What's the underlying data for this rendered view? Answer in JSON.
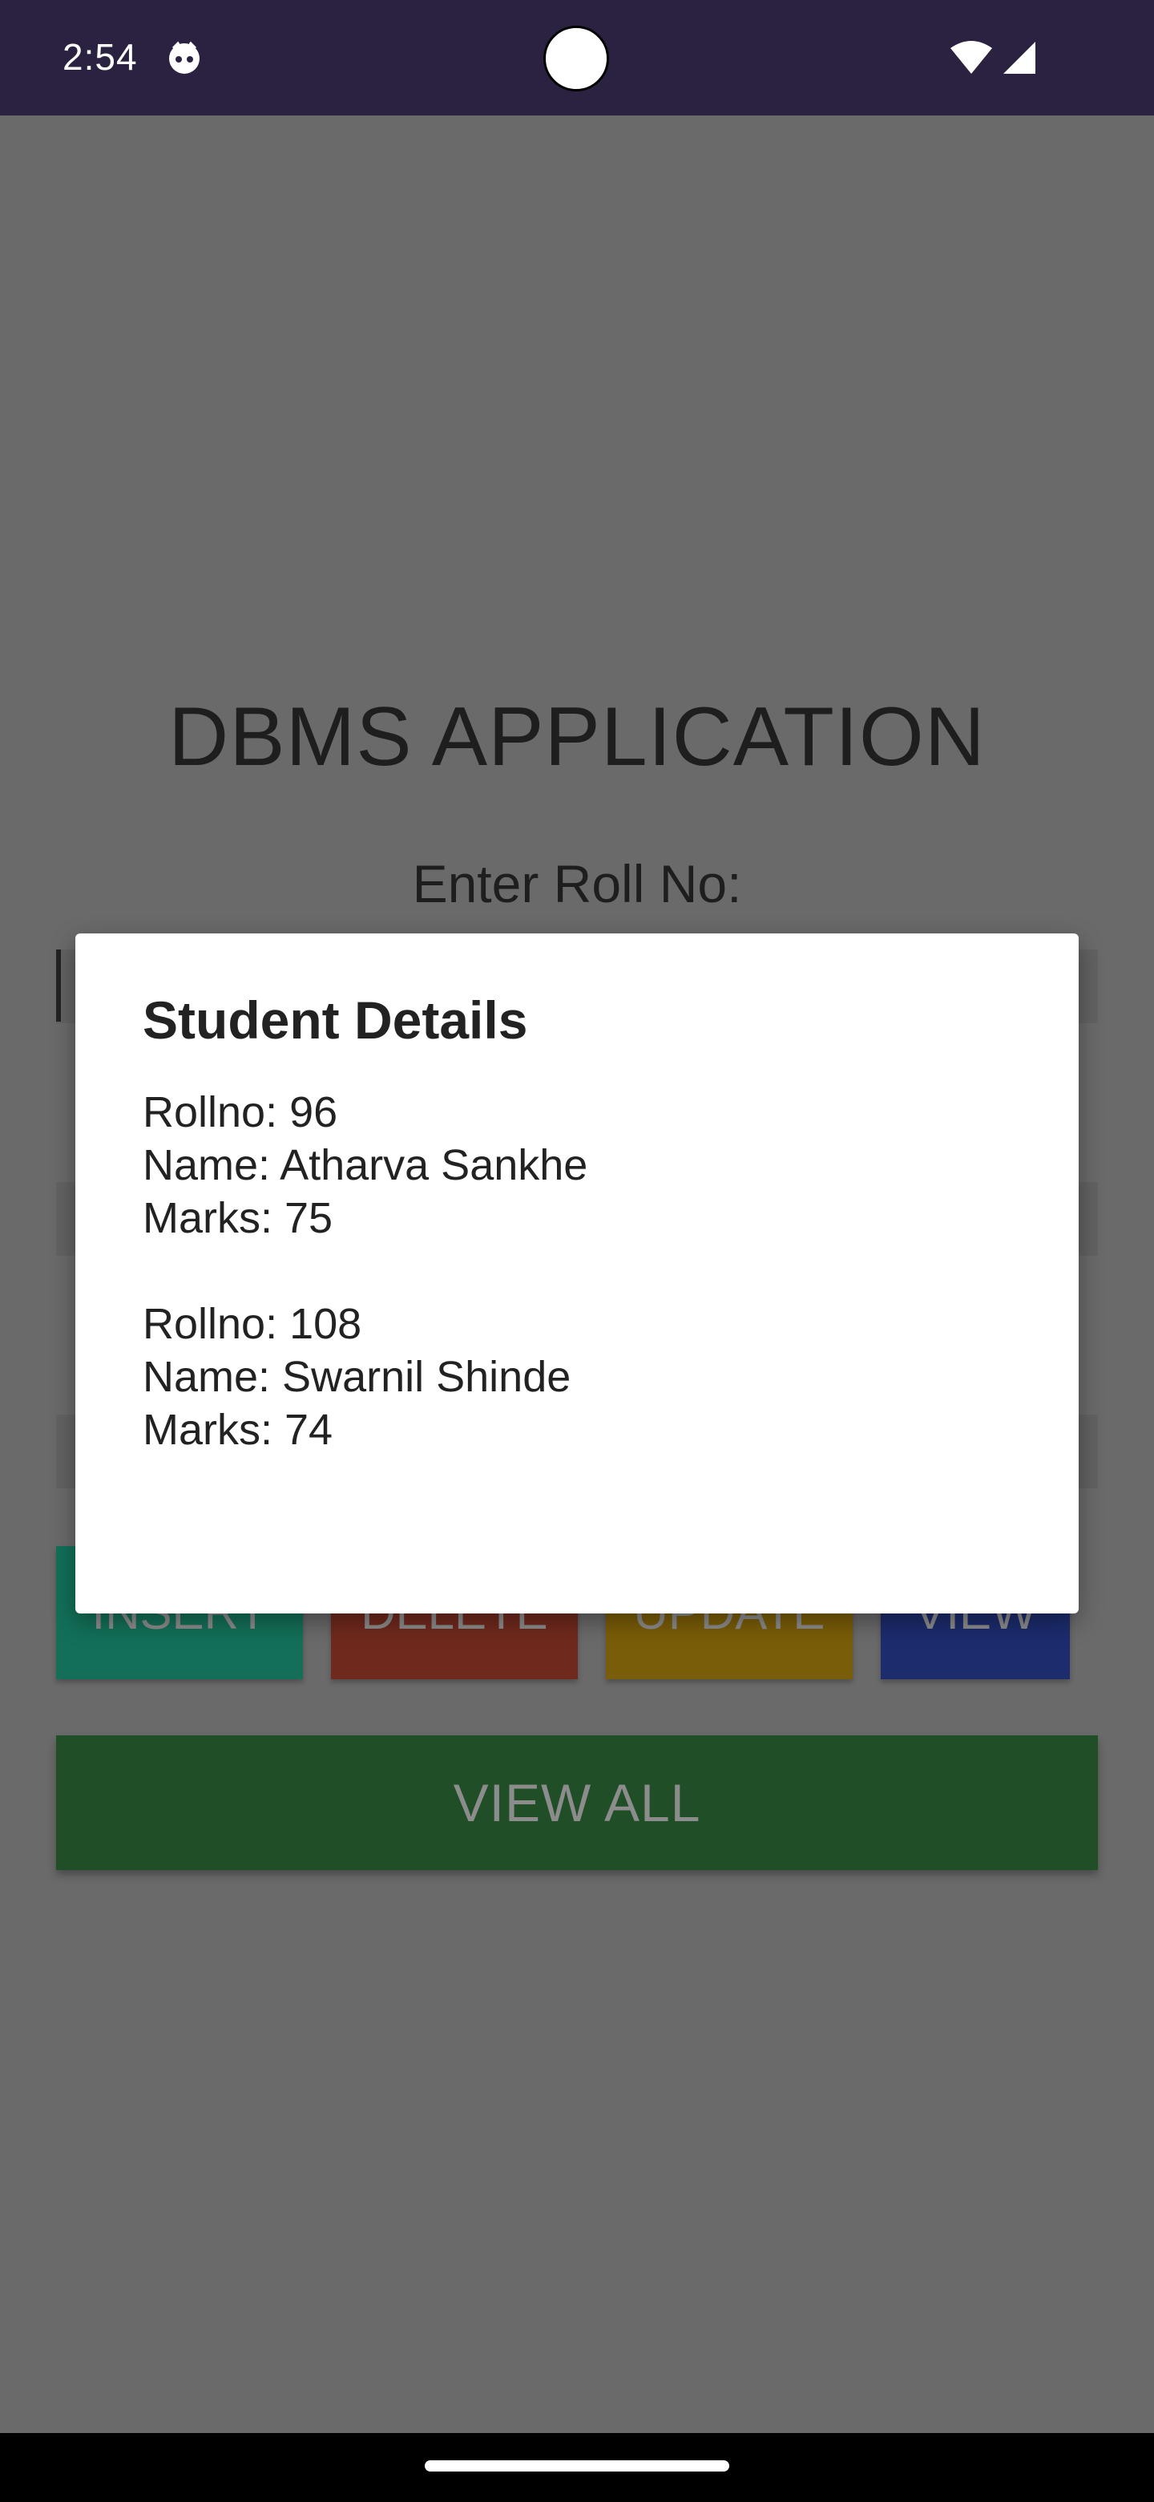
{
  "status_bar": {
    "time": "2:54",
    "icons": [
      "face-icon",
      "wifi-icon",
      "signal-icon"
    ]
  },
  "app": {
    "title": "DBMS APPLICATION",
    "roll_label": "Enter Roll No:",
    "buttons": {
      "insert": "INSERT",
      "delete": "DELETE",
      "update": "UPDATE",
      "view": "VIEW",
      "view_all": "VIEW ALL"
    }
  },
  "dialog": {
    "title": "Student Details",
    "records": [
      {
        "rollno": "Rollno: 96",
        "name": "Name: Atharva Sankhe",
        "marks": "Marks: 75"
      },
      {
        "rollno": "Rollno: 108",
        "name": "Name: Swarnil Shinde",
        "marks": "Marks: 74"
      }
    ]
  },
  "colors": {
    "status_bar": "#2b2141",
    "scrim": "#6a6a6a",
    "insert": "#136f58",
    "delete": "#70291d",
    "update": "#7a5d08",
    "view": "#1c2c6d",
    "view_all": "#1f4e27"
  }
}
